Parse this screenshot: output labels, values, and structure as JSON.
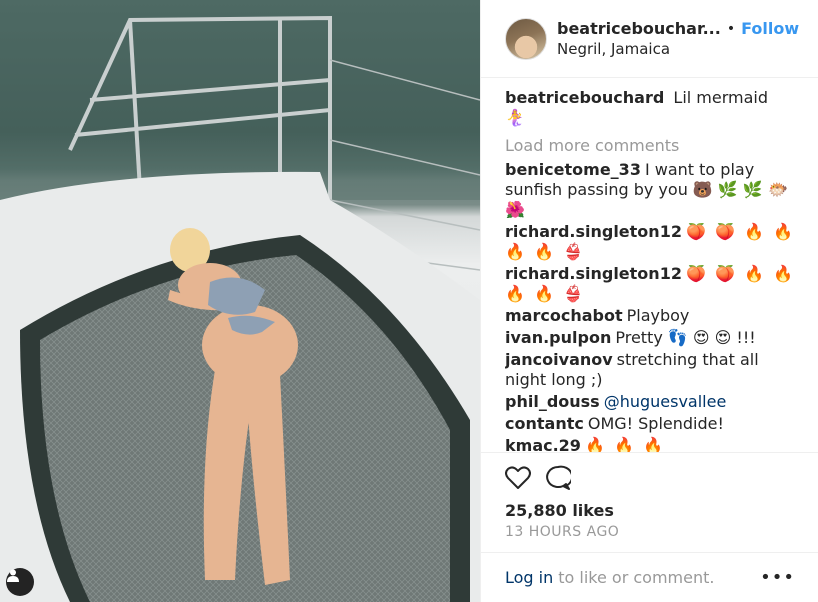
{
  "header": {
    "username": "beatricebouchar...",
    "separator": "•",
    "follow_label": "Follow",
    "location": "Negril, Jamaica"
  },
  "caption": {
    "username": "beatricebouchard",
    "text": "Lil mermaid",
    "emoji": "🧜‍♀️"
  },
  "load_more_label": "Load more comments",
  "comments": [
    {
      "username": "benicetome_33",
      "text": "I want to play sunfish passing by you 🐻 🌿 🌿 🐡 🌺"
    },
    {
      "username": "richard.singleton12",
      "text": "🍑 🍑 🔥 🔥 🔥 🔥 👙"
    },
    {
      "username": "richard.singleton12",
      "text": "🍑 🍑 🔥 🔥 🔥 🔥 👙"
    },
    {
      "username": "marcochabot",
      "text": "Playboy"
    },
    {
      "username": "ivan.pulpon",
      "text": "Pretty 👣 😍 😍 !!!"
    },
    {
      "username": "jancoivanov",
      "text": "stretching that all night long ;)"
    },
    {
      "username": "phil_douss",
      "text": "",
      "mention": "@huguesvallee"
    },
    {
      "username": "contantc",
      "text": "OMG! Splendide!"
    },
    {
      "username": "kmac.29",
      "text": "🔥 🔥 🔥"
    }
  ],
  "likes": "25,880 likes",
  "time": "13 HOURS AGO",
  "login": {
    "link": "Log in",
    "text": "to like or comment.",
    "more": "•••"
  },
  "icons": {
    "like": "heart-icon",
    "comment": "comment-bubble-icon",
    "tag": "person-tag-icon"
  },
  "colors": {
    "accent": "#3897f0",
    "link": "#003569",
    "muted": "#999999"
  }
}
